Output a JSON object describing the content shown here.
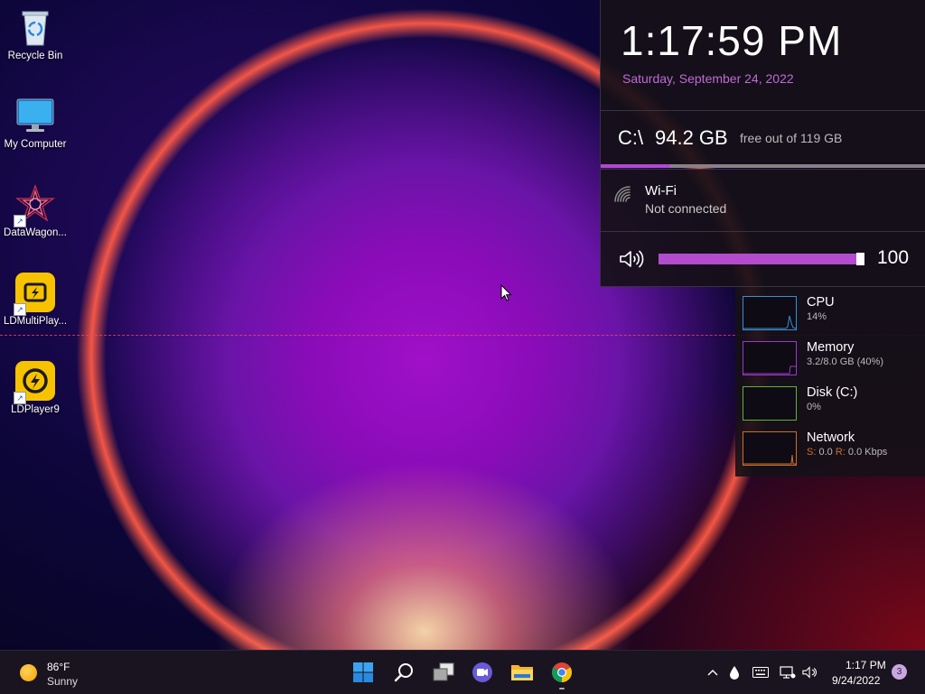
{
  "desktop": {
    "icons": [
      {
        "label": "Recycle Bin",
        "icon": "recycle-bin-icon"
      },
      {
        "label": "My Computer",
        "icon": "monitor-icon"
      },
      {
        "label": "DataWagon...",
        "icon": "datawagon-icon",
        "shortcut": true
      },
      {
        "label": "LDMultiPlay...",
        "icon": "ldmultiplayer-icon",
        "shortcut": true
      },
      {
        "label": "LDPlayer9",
        "icon": "ldplayer-icon",
        "shortcut": true
      }
    ]
  },
  "widgets": {
    "clock": {
      "time": "1:17:59 PM",
      "date": "Saturday, September 24, 2022"
    },
    "disk": {
      "drive": "C:\\",
      "free": "94.2 GB",
      "of_text": "free out of 119 GB",
      "used_fraction": 0.21
    },
    "wifi": {
      "name": "Wi-Fi",
      "status": "Not connected"
    },
    "volume": {
      "value": "100",
      "level": 1.0
    },
    "perf": [
      {
        "name": "CPU",
        "value": "14%",
        "color": "#3a8fd0"
      },
      {
        "name": "Memory",
        "value": "3.2/8.0 GB (40%)",
        "color": "#9a3ac8"
      },
      {
        "name": "Disk (C:)",
        "value": "0%",
        "color": "#5fb33a"
      },
      {
        "name": "Network",
        "value_s_label": "S:",
        "value_s": "0.0",
        "value_r_label": "R:",
        "value_r": "0.0 Kbps",
        "color": "#c8702a"
      }
    ]
  },
  "taskbar": {
    "weather": {
      "temp": "86°F",
      "condition": "Sunny"
    },
    "apps": [
      "start-icon",
      "search-icon",
      "task-view-icon",
      "chat-icon",
      "file-explorer-icon",
      "chrome-icon"
    ],
    "tray": {
      "time": "1:17 PM",
      "date": "9/24/2022",
      "notifications": "3"
    }
  },
  "colors": {
    "accent": "#b24ccc",
    "date_text": "#c06ad6"
  }
}
